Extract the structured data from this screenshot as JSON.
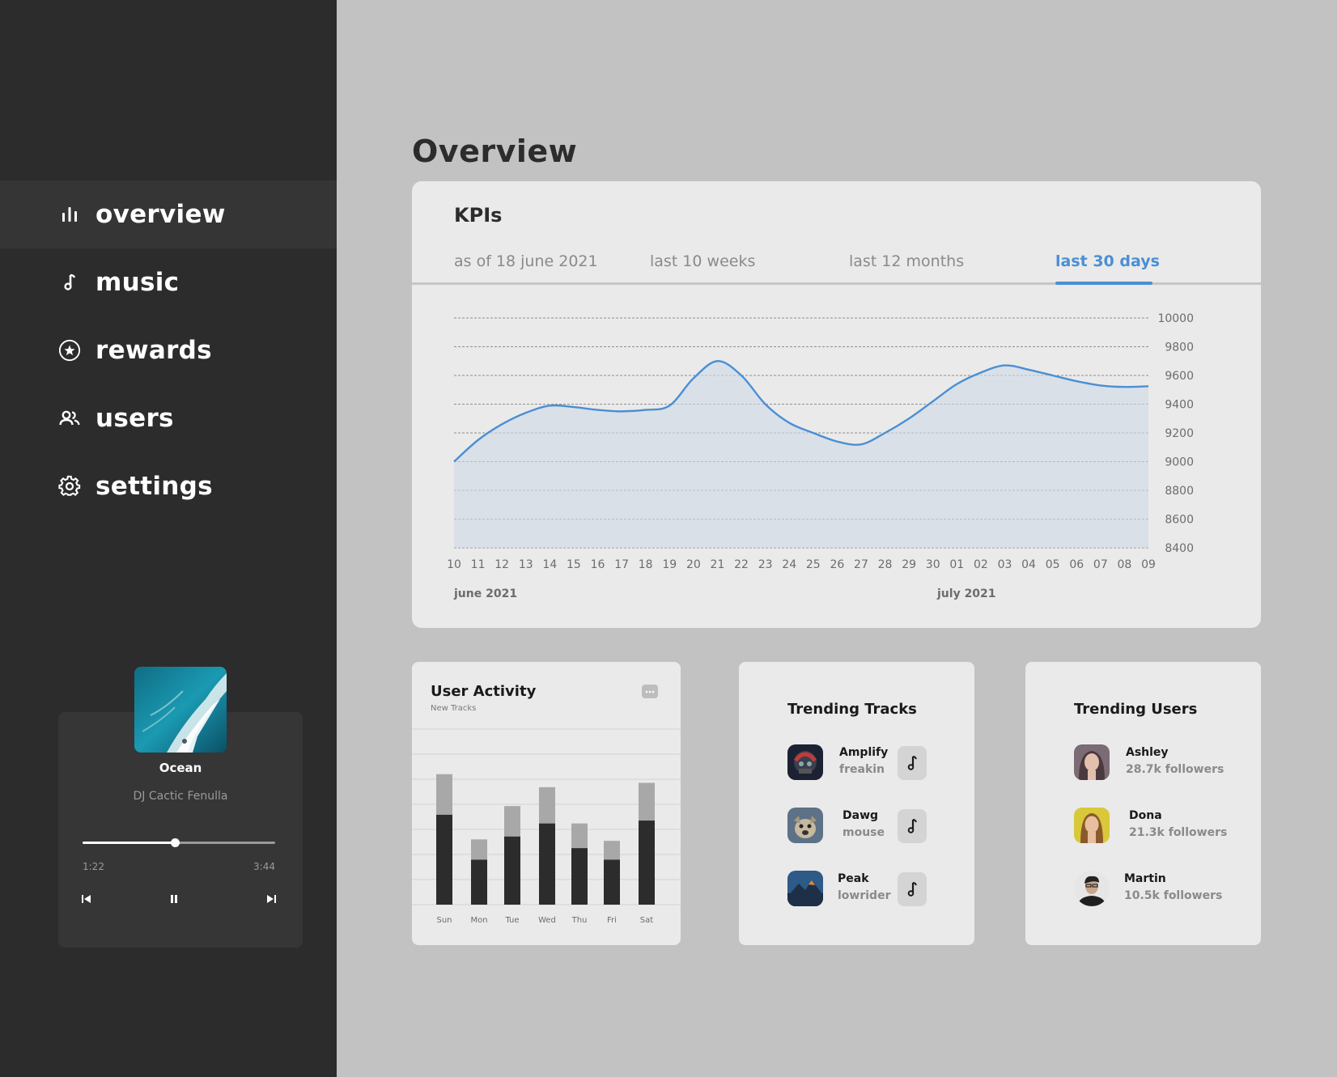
{
  "sidebar": {
    "items": [
      {
        "label": "overview",
        "icon": "bar-chart-icon",
        "active": true
      },
      {
        "label": "music",
        "icon": "music-note-icon"
      },
      {
        "label": "rewards",
        "icon": "star-badge-icon"
      },
      {
        "label": "users",
        "icon": "users-icon"
      },
      {
        "label": "settings",
        "icon": "gear-icon"
      }
    ]
  },
  "player": {
    "title": "Ocean",
    "artist": "DJ Cactic Fenulla",
    "current_time": "1:22",
    "total_time": "3:44",
    "progress": 0.48
  },
  "main": {
    "title": "Overview"
  },
  "kpi": {
    "title": "KPIs",
    "tabs": [
      {
        "label": "as of 18 june 2021"
      },
      {
        "label": "last 10 weeks"
      },
      {
        "label": "last 12 months"
      },
      {
        "label": "last 30 days",
        "active": true
      }
    ],
    "month_labels": [
      "june 2021",
      "july 2021"
    ]
  },
  "user_activity": {
    "title": "User Activity",
    "subtitle": "New Tracks"
  },
  "trending_tracks": {
    "title": "Trending Tracks",
    "items": [
      {
        "name": "Amplify",
        "artist": "freakin"
      },
      {
        "name": "Dawg",
        "artist": "mouse"
      },
      {
        "name": "Peak",
        "artist": "lowrider"
      }
    ]
  },
  "trending_users": {
    "title": "Trending Users",
    "items": [
      {
        "name": "Ashley",
        "followers": "28.7k followers"
      },
      {
        "name": "Dona",
        "followers": "21.3k followers"
      },
      {
        "name": "Martin",
        "followers": "10.5k followers"
      }
    ]
  },
  "colors": {
    "accent": "#4a8fd4",
    "sidebar": "#2c2c2c",
    "bar_dark": "#2c2c2c",
    "bar_light": "#a8a8a8"
  },
  "chart_data": [
    {
      "type": "area",
      "x": [
        "10",
        "11",
        "12",
        "13",
        "14",
        "15",
        "16",
        "17",
        "18",
        "19",
        "20",
        "21",
        "22",
        "23",
        "24",
        "25",
        "26",
        "27",
        "28",
        "29",
        "30",
        "01",
        "02",
        "03",
        "04",
        "05",
        "06",
        "07",
        "08",
        "09"
      ],
      "values": [
        9000,
        9150,
        9260,
        9340,
        9390,
        9380,
        9360,
        9350,
        9360,
        9390,
        9580,
        9700,
        9600,
        9400,
        9270,
        9200,
        9140,
        9120,
        9200,
        9300,
        9420,
        9540,
        9620,
        9670,
        9640,
        9600,
        9560,
        9530,
        9520,
        9525
      ],
      "y_ticks": [
        8400,
        8600,
        8800,
        9000,
        9200,
        9400,
        9600,
        9800,
        10000
      ],
      "ylim": [
        8400,
        10000
      ],
      "grid": true,
      "y_axis_position": "right",
      "color": "#4a8fd4"
    },
    {
      "type": "bar",
      "stacked": true,
      "categories": [
        "Sun",
        "Mon",
        "Tue",
        "Wed",
        "Thu",
        "Fri",
        "Sat"
      ],
      "series": [
        {
          "values": [
            0.62,
            0.31,
            0.47,
            0.56,
            0.39,
            0.31,
            0.58
          ]
        },
        {
          "values": [
            0.28,
            0.14,
            0.21,
            0.25,
            0.17,
            0.13,
            0.26
          ]
        }
      ],
      "ylim": [
        0,
        1
      ],
      "grid": true
    }
  ]
}
